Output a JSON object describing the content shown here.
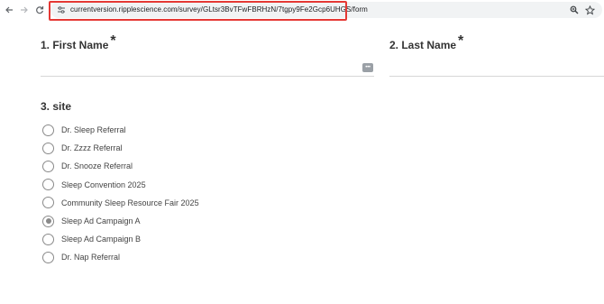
{
  "browser": {
    "url": "currentversion.ripplescience.com/survey/GLtsr3BvTFwFBRHzN/7tgpy9Fe2Gcp6UHGS/form",
    "highlight_color": "#e53935",
    "icons": [
      "back-arrow-icon",
      "forward-arrow-icon",
      "reload-icon",
      "site-info-icon",
      "zoom-icon",
      "bookmark-star-icon"
    ]
  },
  "form": {
    "questions": [
      {
        "number_title": "1. First Name",
        "required_mark": "*",
        "value": ""
      },
      {
        "number_title": "2. Last Name",
        "required_mark": "*",
        "value": ""
      },
      {
        "number_title": "3. site"
      }
    ],
    "password_manager_label": "•••",
    "site_options": [
      {
        "label": "Dr. Sleep Referral",
        "selected": false
      },
      {
        "label": "Dr. Zzzz Referral",
        "selected": false
      },
      {
        "label": "Dr. Snooze Referral",
        "selected": false
      },
      {
        "label": "Sleep Convention 2025",
        "selected": false
      },
      {
        "label": "Community Sleep Resource Fair 2025",
        "selected": false
      },
      {
        "label": "Sleep Ad Campaign A",
        "selected": true
      },
      {
        "label": "Sleep Ad Campaign B",
        "selected": false
      },
      {
        "label": "Dr. Nap Referral",
        "selected": false
      }
    ]
  }
}
